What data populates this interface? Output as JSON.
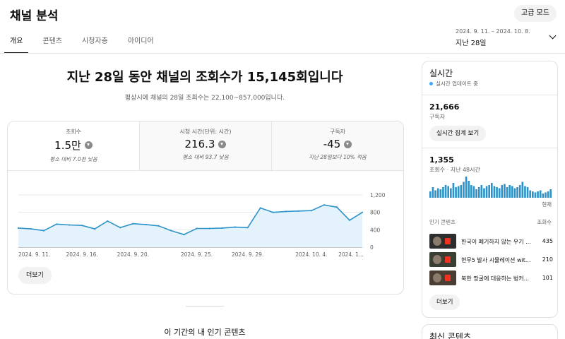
{
  "header": {
    "title": "채널 분석",
    "advanced_mode": "고급 모드"
  },
  "tabs": [
    {
      "label": "개요",
      "active": true
    },
    {
      "label": "콘텐츠",
      "active": false
    },
    {
      "label": "시청자층",
      "active": false
    },
    {
      "label": "아이디어",
      "active": false
    }
  ],
  "date_range": {
    "range": "2024. 9. 11. – 2024. 10. 8.",
    "label": "지난 28일"
  },
  "summary": {
    "headline": "지난 28일 동안 채널의 조회수가 15,145회입니다",
    "subline": "평상시에 채널의 28일 조회수는 22,100~857,000입니다."
  },
  "metrics": [
    {
      "label": "조회수",
      "value": "1.5만",
      "note": "평소 대비 7.0천 낮음",
      "active": true
    },
    {
      "label": "시청 시간(단위: 시간)",
      "value": "216.3",
      "note": "평소 대비 93.7 낮음",
      "active": false
    },
    {
      "label": "구독자",
      "value": "-45",
      "note": "지난 28일보다 10% 적음",
      "active": false
    }
  ],
  "chart_data": {
    "type": "area",
    "x": [
      "2024-09-11",
      "2024-09-12",
      "2024-09-13",
      "2024-09-14",
      "2024-09-15",
      "2024-09-16",
      "2024-09-17",
      "2024-09-18",
      "2024-09-19",
      "2024-09-20",
      "2024-09-21",
      "2024-09-22",
      "2024-09-23",
      "2024-09-24",
      "2024-09-25",
      "2024-09-26",
      "2024-09-27",
      "2024-09-28",
      "2024-09-29",
      "2024-09-30",
      "2024-10-01",
      "2024-10-02",
      "2024-10-03",
      "2024-10-04",
      "2024-10-05",
      "2024-10-06",
      "2024-10-07",
      "2024-10-08"
    ],
    "y": [
      440,
      420,
      380,
      530,
      510,
      500,
      420,
      600,
      450,
      540,
      520,
      490,
      380,
      290,
      430,
      430,
      440,
      460,
      450,
      900,
      800,
      820,
      830,
      840,
      970,
      920,
      620,
      800
    ],
    "tick_labels": [
      "2024. 9. 11.",
      "2024. 9. 16.",
      "2024. 9. 20.",
      "2024. 9. 25.",
      "2024. 9. 29.",
      "2024. 10. 4.",
      "2024. 1..."
    ],
    "tick_index": [
      0,
      5,
      9,
      14,
      18,
      23,
      27
    ],
    "yticks": [
      "0",
      "400",
      "800",
      "1,200"
    ],
    "ylim": [
      0,
      1200
    ],
    "grid": true,
    "line_color": "#2b93c9",
    "fill_color": "#e3f2fb"
  },
  "more_button": "더보기",
  "top_content_title": "이 기간의 내 인기 콘텐츠",
  "realtime": {
    "title": "실시간",
    "status": "실시간 업데이트 중",
    "subscribers": "21,666",
    "subscribers_label": "구독자",
    "live_count_button": "실시간 집계 보기",
    "views": "1,355",
    "views_label": "조회수 · 지난 48시간",
    "bars": [
      0.3,
      0.5,
      0.35,
      0.45,
      0.4,
      0.5,
      0.6,
      0.55,
      0.45,
      0.7,
      0.5,
      0.55,
      0.6,
      0.75,
      1.0,
      0.8,
      0.6,
      0.55,
      0.4,
      0.5,
      0.6,
      0.45,
      0.55,
      0.6,
      0.7,
      0.55,
      0.5,
      0.45,
      0.6,
      0.65,
      0.5,
      0.6,
      0.55,
      0.45,
      0.5,
      0.6,
      0.75,
      0.55,
      0.5,
      0.35,
      0.3,
      0.25,
      0.3,
      0.35,
      0.2,
      0.25,
      0.3,
      0.4
    ],
    "now_label": "현재",
    "popular_header": "인기 콘텐츠",
    "views_header": "조회수",
    "videos": [
      {
        "title": "한국이 폐기하지 않는 우기 ...",
        "views": "435"
      },
      {
        "title": "현무5 발사 시뮬레이션 wit...",
        "views": "210"
      },
      {
        "title": "북한 땅굴에 대응하는 벙커...",
        "views": "101"
      }
    ],
    "more_button": "더보기",
    "bar_color": "#2b93c9"
  },
  "latest": {
    "title": "최신 콘텐츠"
  }
}
